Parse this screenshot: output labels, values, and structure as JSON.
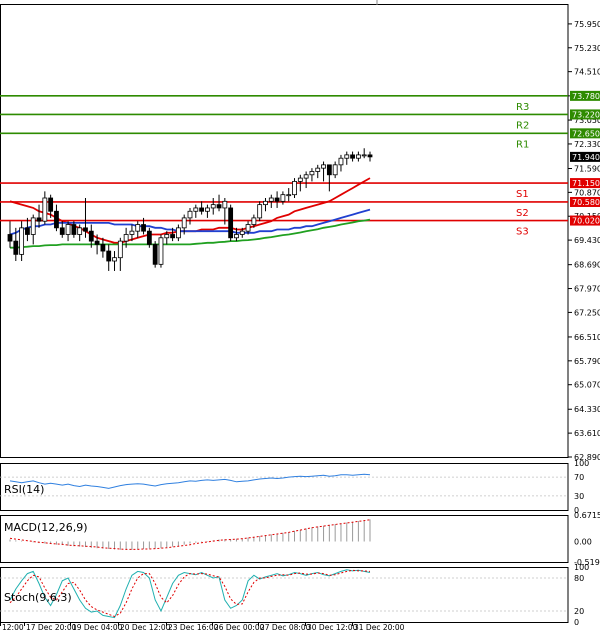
{
  "chart_data": [
    {
      "panel": "price",
      "type": "candlestick",
      "ylim": [
        62.89,
        76.55
      ],
      "y_ticks": [
        "75.950",
        "75.230",
        "74.510",
        "73.780",
        "73.050",
        "72.330",
        "71.590",
        "70.870",
        "70.150",
        "69.430",
        "68.690",
        "67.970",
        "67.250",
        "66.510",
        "65.790",
        "65.070",
        "64.330",
        "63.610",
        "62.890"
      ],
      "x_ticks": [
        "12:00",
        "17 Dec 20:00",
        "19 Dec 04:00",
        "20 Dec 12:00",
        "23 Dec 16:00",
        "26 Dec 00:00",
        "27 Dec 08:00",
        "30 Dec 12:00",
        "31 Dec 20:00"
      ],
      "current_price": {
        "label": "71.940",
        "value": 71.94
      },
      "levels": [
        {
          "name": "R3",
          "value": 73.78,
          "label": "73.780",
          "color": "#2e8b00"
        },
        {
          "name": "R2",
          "value": 73.22,
          "label": "73.220",
          "color": "#2e8b00"
        },
        {
          "name": "R1",
          "value": 72.65,
          "label": "72.650",
          "color": "#2e8b00"
        },
        {
          "name": "S1",
          "value": 71.15,
          "label": "71.150",
          "color": "#e00000"
        },
        {
          "name": "S2",
          "value": 70.58,
          "label": "70.580",
          "color": "#e00000"
        },
        {
          "name": "S3",
          "value": 70.02,
          "label": "70.020",
          "color": "#e00000"
        }
      ],
      "candles": [
        {
          "o": 69.6,
          "h": 70.0,
          "l": 69.2,
          "c": 69.4
        },
        {
          "o": 69.4,
          "h": 69.8,
          "l": 68.8,
          "c": 69.0
        },
        {
          "o": 69.0,
          "h": 70.0,
          "l": 68.8,
          "c": 69.8
        },
        {
          "o": 69.8,
          "h": 70.1,
          "l": 69.4,
          "c": 69.6
        },
        {
          "o": 69.6,
          "h": 70.2,
          "l": 69.3,
          "c": 70.1
        },
        {
          "o": 70.1,
          "h": 70.5,
          "l": 69.8,
          "c": 70.0
        },
        {
          "o": 70.0,
          "h": 70.9,
          "l": 69.9,
          "c": 70.7
        },
        {
          "o": 70.7,
          "h": 70.8,
          "l": 70.1,
          "c": 70.3
        },
        {
          "o": 70.3,
          "h": 70.5,
          "l": 69.7,
          "c": 69.8
        },
        {
          "o": 69.8,
          "h": 70.0,
          "l": 69.5,
          "c": 69.6
        },
        {
          "o": 69.6,
          "h": 70.0,
          "l": 69.4,
          "c": 69.9
        },
        {
          "o": 69.9,
          "h": 70.0,
          "l": 69.5,
          "c": 69.6
        },
        {
          "o": 69.6,
          "h": 69.9,
          "l": 69.4,
          "c": 69.8
        },
        {
          "o": 69.8,
          "h": 70.7,
          "l": 69.5,
          "c": 69.7
        },
        {
          "o": 69.7,
          "h": 69.9,
          "l": 69.2,
          "c": 69.4
        },
        {
          "o": 69.4,
          "h": 69.6,
          "l": 69.0,
          "c": 69.3
        },
        {
          "o": 69.3,
          "h": 69.5,
          "l": 68.9,
          "c": 69.1
        },
        {
          "o": 69.1,
          "h": 69.3,
          "l": 68.5,
          "c": 68.8
        },
        {
          "o": 68.8,
          "h": 69.1,
          "l": 68.5,
          "c": 68.9
        },
        {
          "o": 68.9,
          "h": 69.5,
          "l": 68.5,
          "c": 69.4
        },
        {
          "o": 69.4,
          "h": 69.8,
          "l": 69.2,
          "c": 69.6
        },
        {
          "o": 69.6,
          "h": 69.9,
          "l": 69.4,
          "c": 69.7
        },
        {
          "o": 69.7,
          "h": 70.0,
          "l": 69.5,
          "c": 69.9
        },
        {
          "o": 69.9,
          "h": 70.1,
          "l": 69.6,
          "c": 69.7
        },
        {
          "o": 69.7,
          "h": 69.8,
          "l": 69.2,
          "c": 69.3
        },
        {
          "o": 69.3,
          "h": 69.4,
          "l": 68.6,
          "c": 68.7
        },
        {
          "o": 68.7,
          "h": 69.6,
          "l": 68.6,
          "c": 69.5
        },
        {
          "o": 69.5,
          "h": 69.7,
          "l": 69.3,
          "c": 69.6
        },
        {
          "o": 69.6,
          "h": 69.8,
          "l": 69.4,
          "c": 69.5
        },
        {
          "o": 69.5,
          "h": 69.9,
          "l": 69.4,
          "c": 69.8
        },
        {
          "o": 69.8,
          "h": 70.2,
          "l": 69.6,
          "c": 70.1
        },
        {
          "o": 70.1,
          "h": 70.4,
          "l": 69.9,
          "c": 70.3
        },
        {
          "o": 70.3,
          "h": 70.5,
          "l": 70.1,
          "c": 70.4
        },
        {
          "o": 70.4,
          "h": 70.6,
          "l": 70.2,
          "c": 70.3
        },
        {
          "o": 70.3,
          "h": 70.5,
          "l": 70.1,
          "c": 70.4
        },
        {
          "o": 70.4,
          "h": 70.7,
          "l": 70.2,
          "c": 70.5
        },
        {
          "o": 70.5,
          "h": 70.8,
          "l": 70.3,
          "c": 70.4
        },
        {
          "o": 70.4,
          "h": 70.7,
          "l": 69.9,
          "c": 70.6
        },
        {
          "o": 70.4,
          "h": 70.5,
          "l": 69.4,
          "c": 69.5
        },
        {
          "o": 69.5,
          "h": 69.8,
          "l": 69.4,
          "c": 69.6
        },
        {
          "o": 69.6,
          "h": 69.8,
          "l": 69.5,
          "c": 69.7
        },
        {
          "o": 69.7,
          "h": 70.0,
          "l": 69.6,
          "c": 69.9
        },
        {
          "o": 69.9,
          "h": 70.2,
          "l": 69.8,
          "c": 70.1
        },
        {
          "o": 70.1,
          "h": 70.6,
          "l": 70.0,
          "c": 70.5
        },
        {
          "o": 70.5,
          "h": 70.7,
          "l": 70.3,
          "c": 70.6
        },
        {
          "o": 70.6,
          "h": 70.8,
          "l": 70.4,
          "c": 70.7
        },
        {
          "o": 70.7,
          "h": 70.9,
          "l": 70.4,
          "c": 70.6
        },
        {
          "o": 70.6,
          "h": 70.9,
          "l": 70.5,
          "c": 70.8
        },
        {
          "o": 70.8,
          "h": 71.0,
          "l": 70.6,
          "c": 70.8
        },
        {
          "o": 70.8,
          "h": 71.3,
          "l": 70.7,
          "c": 71.2
        },
        {
          "o": 71.2,
          "h": 71.4,
          "l": 70.9,
          "c": 71.3
        },
        {
          "o": 71.3,
          "h": 71.5,
          "l": 71.0,
          "c": 71.4
        },
        {
          "o": 71.4,
          "h": 71.6,
          "l": 71.2,
          "c": 71.5
        },
        {
          "o": 71.5,
          "h": 71.7,
          "l": 71.3,
          "c": 71.6
        },
        {
          "o": 71.6,
          "h": 71.8,
          "l": 71.2,
          "c": 71.7
        },
        {
          "o": 71.7,
          "h": 71.7,
          "l": 70.9,
          "c": 71.4
        },
        {
          "o": 71.4,
          "h": 71.8,
          "l": 71.3,
          "c": 71.7
        },
        {
          "o": 71.7,
          "h": 72.0,
          "l": 71.5,
          "c": 71.9
        },
        {
          "o": 71.9,
          "h": 72.1,
          "l": 71.7,
          "c": 72.0
        },
        {
          "o": 72.0,
          "h": 72.1,
          "l": 71.8,
          "c": 71.9
        },
        {
          "o": 71.9,
          "h": 72.1,
          "l": 71.8,
          "c": 72.0
        },
        {
          "o": 72.0,
          "h": 72.2,
          "l": 71.9,
          "c": 72.0
        },
        {
          "o": 72.0,
          "h": 72.1,
          "l": 71.8,
          "c": 71.94
        }
      ],
      "moving_averages": [
        {
          "color": "#e00000",
          "values": [
            70.6,
            70.55,
            70.5,
            70.45,
            70.4,
            70.3,
            70.25,
            70.2,
            70.1,
            70.0,
            69.95,
            69.85,
            69.8,
            69.7,
            69.6,
            69.5,
            69.45,
            69.4,
            69.35,
            69.35,
            69.4,
            69.45,
            69.5,
            69.55,
            69.6,
            69.6,
            69.6,
            69.65,
            69.65,
            69.7,
            69.7,
            69.7,
            69.7,
            69.75,
            69.75,
            69.75,
            69.8,
            69.8,
            69.8,
            69.75,
            69.75,
            69.8,
            69.85,
            69.9,
            69.95,
            70.0,
            70.1,
            70.15,
            70.2,
            70.3,
            70.35,
            70.4,
            70.45,
            70.5,
            70.55,
            70.6,
            70.7,
            70.8,
            70.9,
            71.0,
            71.1,
            71.2,
            71.3
          ]
        },
        {
          "color": "#2040d0",
          "values": [
            69.6,
            69.65,
            69.75,
            69.8,
            69.85,
            69.85,
            69.9,
            69.9,
            69.95,
            69.95,
            69.95,
            69.95,
            69.95,
            69.95,
            69.95,
            69.95,
            69.95,
            69.95,
            69.9,
            69.9,
            69.9,
            69.9,
            69.85,
            69.85,
            69.85,
            69.8,
            69.8,
            69.75,
            69.75,
            69.7,
            69.7,
            69.7,
            69.7,
            69.7,
            69.7,
            69.7,
            69.7,
            69.7,
            69.7,
            69.65,
            69.65,
            69.65,
            69.65,
            69.7,
            69.7,
            69.7,
            69.75,
            69.75,
            69.75,
            69.8,
            69.8,
            69.85,
            69.85,
            69.9,
            69.95,
            70.0,
            70.05,
            70.1,
            70.15,
            70.2,
            70.25,
            70.3,
            70.35
          ]
        },
        {
          "color": "#20a020",
          "values": [
            69.2,
            69.2,
            69.22,
            69.23,
            69.25,
            69.25,
            69.27,
            69.28,
            69.28,
            69.3,
            69.3,
            69.3,
            69.3,
            69.3,
            69.3,
            69.3,
            69.3,
            69.3,
            69.3,
            69.3,
            69.3,
            69.3,
            69.3,
            69.3,
            69.3,
            69.3,
            69.3,
            69.3,
            69.3,
            69.3,
            69.3,
            69.3,
            69.32,
            69.33,
            69.35,
            69.35,
            69.37,
            69.38,
            69.4,
            69.4,
            69.42,
            69.43,
            69.45,
            69.47,
            69.5,
            69.52,
            69.55,
            69.58,
            69.6,
            69.63,
            69.66,
            69.7,
            69.73,
            69.76,
            69.8,
            69.83,
            69.86,
            69.9,
            69.93,
            69.96,
            70.0,
            70.02,
            70.05
          ]
        }
      ]
    },
    {
      "panel": "rsi",
      "type": "line",
      "title": "RSI(14)",
      "ylim": [
        0,
        100
      ],
      "y_ticks": [
        "100",
        "70",
        "30",
        "0"
      ],
      "color": "#3080e0",
      "values": [
        62,
        60,
        58,
        60,
        62,
        58,
        55,
        57,
        55,
        53,
        55,
        52,
        50,
        53,
        51,
        50,
        48,
        46,
        49,
        52,
        54,
        55,
        56,
        55,
        53,
        51,
        54,
        56,
        57,
        58,
        60,
        62,
        61,
        63,
        64,
        63,
        64,
        65,
        63,
        60,
        61,
        62,
        64,
        66,
        67,
        68,
        67,
        68,
        70,
        71,
        72,
        71,
        72,
        73,
        74,
        72,
        73,
        75,
        75,
        74,
        75,
        76,
        75
      ]
    },
    {
      "panel": "macd",
      "type": "bar",
      "title": "MACD(12,26,9)",
      "ylim": [
        -0.5192,
        0.6715
      ],
      "y_ticks": [
        "0.6715",
        "0.00",
        "-0.5192"
      ],
      "signal_color": "#e00000",
      "hist_color": "#9a9a9a",
      "histogram": [
        0.05,
        0.03,
        0.02,
        0.0,
        -0.02,
        -0.04,
        -0.05,
        -0.06,
        -0.08,
        -0.09,
        -0.11,
        -0.12,
        -0.13,
        -0.14,
        -0.16,
        -0.17,
        -0.18,
        -0.19,
        -0.2,
        -0.21,
        -0.21,
        -0.21,
        -0.2,
        -0.19,
        -0.18,
        -0.18,
        -0.17,
        -0.15,
        -0.13,
        -0.11,
        -0.08,
        -0.05,
        -0.03,
        -0.01,
        0.01,
        0.03,
        0.05,
        0.06,
        0.06,
        0.07,
        0.08,
        0.1,
        0.12,
        0.14,
        0.16,
        0.18,
        0.2,
        0.22,
        0.24,
        0.27,
        0.3,
        0.33,
        0.36,
        0.38,
        0.4,
        0.42,
        0.44,
        0.46,
        0.48,
        0.5,
        0.52,
        0.54,
        0.56
      ],
      "signal": [
        0.08,
        0.06,
        0.04,
        0.02,
        0.0,
        -0.02,
        -0.03,
        -0.05,
        -0.06,
        -0.07,
        -0.09,
        -0.1,
        -0.11,
        -0.12,
        -0.13,
        -0.14,
        -0.16,
        -0.17,
        -0.18,
        -0.19,
        -0.2,
        -0.2,
        -0.2,
        -0.19,
        -0.19,
        -0.18,
        -0.17,
        -0.16,
        -0.14,
        -0.12,
        -0.1,
        -0.08,
        -0.05,
        -0.03,
        -0.01,
        0.01,
        0.03,
        0.04,
        0.05,
        0.06,
        0.07,
        0.09,
        0.11,
        0.13,
        0.15,
        0.17,
        0.19,
        0.21,
        0.23,
        0.26,
        0.29,
        0.32,
        0.35,
        0.37,
        0.39,
        0.41,
        0.43,
        0.45,
        0.47,
        0.49,
        0.51,
        0.53,
        0.55
      ]
    },
    {
      "panel": "stoch",
      "type": "line",
      "title": "Stoch(9,6,3)",
      "ylim": [
        0,
        100
      ],
      "y_ticks": [
        "100",
        "80",
        "20",
        "0"
      ],
      "main_color": "#20b0b0",
      "signal_color": "#e00000",
      "main": [
        40,
        60,
        75,
        88,
        92,
        70,
        45,
        30,
        50,
        75,
        80,
        60,
        40,
        25,
        18,
        20,
        12,
        10,
        8,
        30,
        60,
        85,
        92,
        90,
        80,
        40,
        20,
        45,
        70,
        85,
        90,
        88,
        86,
        90,
        85,
        80,
        82,
        40,
        25,
        30,
        40,
        75,
        85,
        78,
        82,
        85,
        88,
        84,
        86,
        90,
        88,
        85,
        88,
        90,
        86,
        84,
        88,
        92,
        95,
        93,
        94,
        92,
        90
      ],
      "signal": [
        35,
        45,
        60,
        75,
        85,
        82,
        62,
        45,
        40,
        55,
        70,
        72,
        58,
        40,
        28,
        22,
        18,
        14,
        10,
        16,
        35,
        60,
        80,
        88,
        88,
        70,
        45,
        35,
        48,
        68,
        82,
        88,
        87,
        88,
        87,
        84,
        82,
        65,
        42,
        32,
        33,
        55,
        72,
        80,
        80,
        83,
        85,
        86,
        85,
        88,
        89,
        87,
        87,
        89,
        88,
        85,
        86,
        89,
        92,
        94,
        93,
        93,
        92
      ]
    }
  ]
}
